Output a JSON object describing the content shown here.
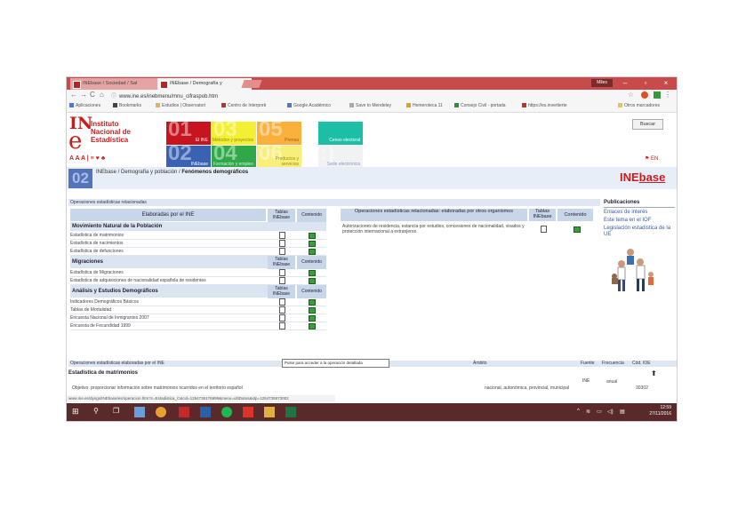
{
  "browser": {
    "tabs": [
      {
        "label": "INEbase / Sociedad / Sal"
      },
      {
        "label": "INEbase / Demografía y"
      }
    ],
    "user_chip": "Miles",
    "url": "www.ine.es/inebmenu/mnu_cifraspob.htm",
    "bookmarks": [
      "Aplicaciones",
      "Bookmarks",
      "Estudios | Observatori",
      "Centro de Interpreti",
      "Google Académico",
      "Save to Mendeley",
      "Hemeroteca 11",
      "Consejo Civil - portada",
      "https://es.invertierte",
      "Otros marcadores"
    ]
  },
  "site": {
    "logo_in": "IN",
    "logo_e": "e",
    "institute": [
      "Instituto",
      "Nacional de",
      "Estadística"
    ],
    "accessibility": "A A A | ≡ ♥ ♣",
    "search_button": "Buscar",
    "lang": "EN",
    "tiles": [
      {
        "num": "01",
        "label": "El INE",
        "color": "#c8141e",
        "text_color": "#ffffff"
      },
      {
        "num": "03",
        "label": "Métodos y proyectos",
        "color": "#f3ef33",
        "text_color": "#9a8a10"
      },
      {
        "num": "05",
        "label": "Prensa",
        "color": "#fbb03b",
        "text_color": "#9a6010"
      },
      {
        "num": "",
        "label": "Censo electoral",
        "color": "#1cbfa6",
        "text_color": "#ffffff"
      },
      {
        "num": "02",
        "label": "INEbase",
        "color": "#3a62b0",
        "text_color": "#ffffff"
      },
      {
        "num": "04",
        "label": "Formación y empleo",
        "color": "#2fa84a",
        "text_color": "#d5f0d0"
      },
      {
        "num": "06",
        "label": "Productos y servicios",
        "color": "#f8ef7a",
        "text_color": "#9a8a10"
      },
      {
        "num": ":)",
        "label": "Sede electrónica",
        "color": "#f2f2f2",
        "text_color": "#8898c0"
      }
    ],
    "breadcrumb_num": "02",
    "breadcrumb_path": "INEbase / Demografía y población / ",
    "breadcrumb_current": "Fenómenos demográficos",
    "inebase_logo_a": "INE",
    "inebase_logo_b": "base"
  },
  "content": {
    "section_title": "Operaciones estadísticas relacionadas",
    "left_header": "Elaboradas por el INE",
    "col_tablas": "Tablas INEbase",
    "col_contenido": "Contenido",
    "groups": [
      {
        "title": "Movimiento Natural de la Población",
        "rows": [
          "Estadística de matrimonios",
          "Estadística de nacimientos",
          "Estadística de defunciones"
        ]
      },
      {
        "title": "Migraciones",
        "rows": [
          "Estadística de Migraciones",
          "Estadística de adquisiciones de nacionalidad española de residentes"
        ]
      },
      {
        "title": "Análisis y Estudios Demográficos",
        "rows": [
          "Indicadores Demográficos Básicos",
          "Tablas de Mortalidad",
          "Encuesta Nacional de Inmigrantes 2007",
          "Encuesta de Fecundidad 1999"
        ]
      }
    ],
    "right_header": "Operaciones estadísticas relacionadas: elaboradas por otros organismos",
    "right_col_tablas": "Tablas INEbase",
    "right_col_contenido": "Contenido",
    "right_row": "Autorizaciones de residencia, estancia por estudios, concesiones de nacionalidad, visados y protección internacional a extranjeros",
    "publications_title": "Publicaciones",
    "publications": [
      "Enlaces de interés",
      "Este tema en el IOF",
      "Legislación estadística de la UE"
    ],
    "ops_bar": "Operaciones estadísticas elaboradas por el INE",
    "ops_cols": [
      "Ámbito",
      "Fuente",
      "Frecuencia",
      "Cód. IOE"
    ],
    "tooltip": "Pulse para acceder a la operación detallada",
    "est_title": "Estadística de matrimonios",
    "objective": "Objetivo: proporcionar información sobre matrimonios ocurridos en el territorio español",
    "ambito_value": "nacional, autonómica, provincial, municipal",
    "fuente_value": "INE",
    "frecuencia_value": "anual",
    "codigo_value": "30302",
    "status_url": "www.ine.es/dyngs/INEbase/es/operacion.htm?c=Estadistica_C&cid=1254736176999&menu=ultiDatos&idp=1254735573002"
  },
  "taskbar": {
    "time": "12:59",
    "date": "27/11/2016"
  }
}
